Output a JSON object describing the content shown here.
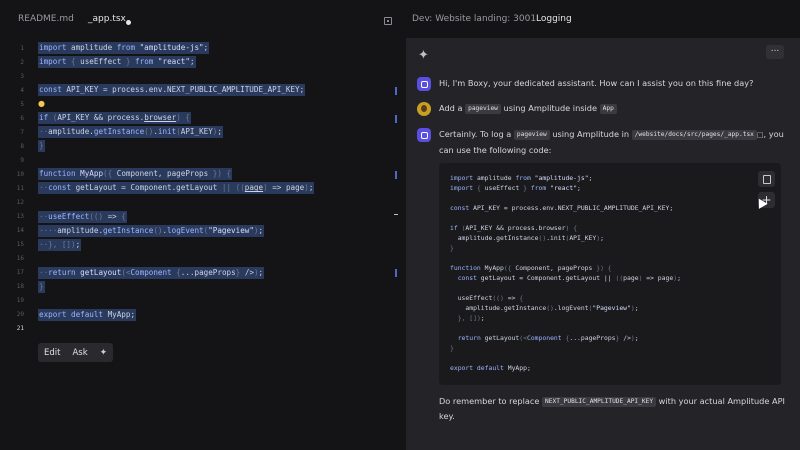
{
  "tabs": [
    {
      "label": "README.md",
      "active": false
    },
    {
      "label": "_app.tsx",
      "active": true,
      "modified": true
    }
  ],
  "editor": {
    "line_numbers": [
      "1",
      "2",
      "3",
      "4",
      "5",
      "6",
      "7",
      "8",
      "9",
      "10",
      "11",
      "12",
      "13",
      "14",
      "15",
      "16",
      "17",
      "18",
      "19",
      "20",
      "21"
    ],
    "lines": [
      "import amplitude from \"amplitude-js\";",
      "import { useEffect } from \"react\";",
      "",
      "const API_KEY = process.env.NEXT_PUBLIC_AMPLITUDE_API_KEY;",
      "",
      "if (API_KEY && process.browser) {",
      "  amplitude.getInstance().init(API_KEY);",
      "}",
      "",
      "function MyApp({ Component, pageProps }) {",
      "  const getLayout = Component.getLayout || ((page) => page);",
      "",
      "  useEffect(() => {",
      "    amplitude.getInstance().logEvent(\"Pageview\");",
      "  }, []);",
      "",
      "  return getLayout(<Component {...pageProps} />);",
      "}",
      "",
      "export default MyApp;",
      ""
    ],
    "toolbar": {
      "edit_label": "Edit",
      "ask_label": "Ask"
    }
  },
  "chat": {
    "header": {
      "title": "Dev: Website landing: 3001",
      "tab": "Logging"
    },
    "more_label": "...",
    "messages": {
      "greeting": "Hi, I'm Boxy, your dedicated assistant. How can I assist you on this fine day?",
      "user_prefix": "Add a",
      "user_pill1": "pageview",
      "user_mid": "using Amplitude inside",
      "user_pill2": "App",
      "reply_prefix": "Certainly. To log a",
      "reply_pill1": "pageview",
      "reply_mid": "using Amplitude in",
      "reply_pill2": "/website/docs/src/pages/_app.tsx",
      "reply_suffix": ", you can use the following code:",
      "footer_prefix": "Do remember to replace",
      "footer_pill": "NEXT_PUBLIC_AMPLITUDE_API_KEY",
      "footer_suffix": "with your actual Amplitude API key."
    },
    "code_lines": [
      "import amplitude from \"amplitude-js\";",
      "import { useEffect } from \"react\";",
      "",
      "const API_KEY = process.env.NEXT_PUBLIC_AMPLITUDE_API_KEY;",
      "",
      "if (API_KEY && process.browser) {",
      "  amplitude.getInstance().init(API_KEY);",
      "}",
      "",
      "function MyApp({ Component, pageProps }) {",
      "  const getLayout = Component.getLayout || ((page) => page);",
      "",
      "  useEffect(() => {",
      "    amplitude.getInstance().logEvent(\"Pageview\");",
      "  }, []);",
      "",
      "  return getLayout(<Component {...pageProps} />);",
      "}",
      "",
      "export default MyApp;"
    ],
    "insert_label": "+"
  }
}
